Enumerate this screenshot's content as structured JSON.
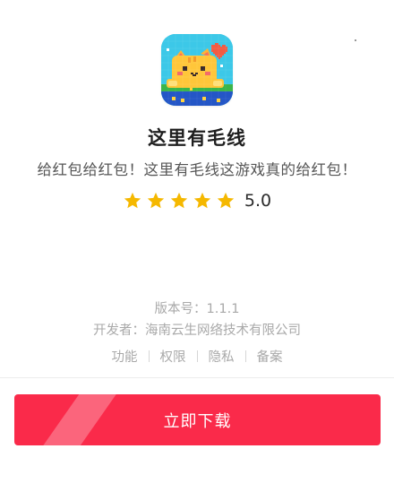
{
  "app": {
    "name": "这里有毛线",
    "tagline": "给红包给红包！这里有毛线这游戏真的给红包！",
    "rating": "5.0",
    "stars": 5,
    "icon": "pixel-cat-app-icon"
  },
  "meta": {
    "version": "版本号：1.1.1",
    "developer": "开发者：海南云生网络技术有限公司"
  },
  "links": [
    "功能",
    "权限",
    "隐私",
    "备案"
  ],
  "download_label": "立即下载",
  "colors": {
    "accent": "#fa2a4a",
    "star": "#f5b800",
    "muted_text": "#a9a9a9"
  }
}
